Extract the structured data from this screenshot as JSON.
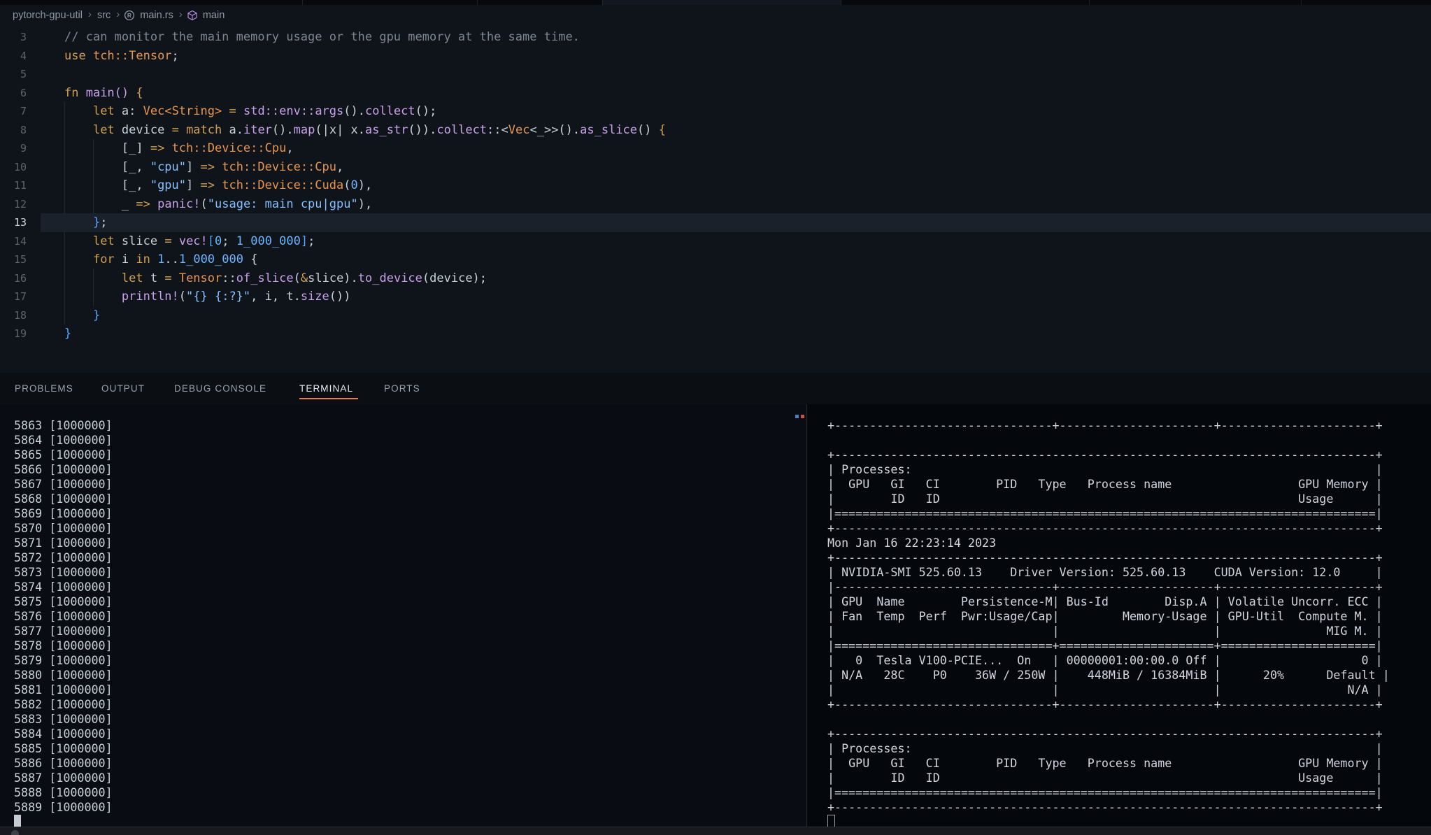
{
  "colors": {
    "accent_underline": "#ee7a50",
    "syntax_keyword": "#d0a050",
    "syntax_type": "#e8964e",
    "syntax_function": "#c9a1e9",
    "syntax_string": "#85c1ff",
    "syntax_number": "#6cb6ff",
    "syntax_comment": "#7d8590",
    "editor_background": "#0f131a",
    "terminal_left_background": "#090d13",
    "terminal_right_background": "#04070c"
  },
  "breadcrumb": {
    "items": [
      {
        "label": "pytorch-gpu-util"
      },
      {
        "label": "src"
      },
      {
        "label": "main.rs",
        "icon": "rust-file-icon"
      },
      {
        "label": "main",
        "icon": "symbol-cube-icon"
      }
    ]
  },
  "editor": {
    "active_line": 13,
    "lines": [
      {
        "n": 3,
        "t": [
          [
            "cm",
            "// can monitor the main memory usage or the gpu memory at the same time."
          ]
        ]
      },
      {
        "n": 4,
        "t": [
          [
            "kw",
            "use "
          ],
          [
            "ty",
            "tch::Tensor"
          ],
          [
            "df",
            ";"
          ]
        ]
      },
      {
        "n": 5,
        "t": []
      },
      {
        "n": 6,
        "t": [
          [
            "kw",
            "fn "
          ],
          [
            "fn",
            "main()"
          ],
          [
            "df",
            " "
          ],
          [
            "kw",
            "{"
          ]
        ]
      },
      {
        "n": 7,
        "t": [
          [
            "df",
            "    "
          ],
          [
            "kw",
            "let"
          ],
          [
            "df",
            " a: "
          ],
          [
            "ty",
            "Vec<String>"
          ],
          [
            "df",
            " "
          ],
          [
            "kw",
            "="
          ],
          [
            "df",
            " "
          ],
          [
            "fn",
            "std::env::args"
          ],
          [
            "df",
            "()."
          ],
          [
            "fn",
            "collect"
          ],
          [
            "df",
            "();"
          ]
        ]
      },
      {
        "n": 8,
        "t": [
          [
            "df",
            "    "
          ],
          [
            "kw",
            "let"
          ],
          [
            "df",
            " device "
          ],
          [
            "kw",
            "="
          ],
          [
            "df",
            " "
          ],
          [
            "kw",
            "match"
          ],
          [
            "df",
            " a."
          ],
          [
            "fn",
            "iter"
          ],
          [
            "df",
            "()."
          ],
          [
            "fn",
            "map"
          ],
          [
            "df",
            "(|x| x."
          ],
          [
            "fn",
            "as_str"
          ],
          [
            "df",
            "())."
          ],
          [
            "fn",
            "collect"
          ],
          [
            "df",
            "::<"
          ],
          [
            "ty",
            "Vec"
          ],
          [
            "df",
            "<_>>()."
          ],
          [
            "fn",
            "as_slice"
          ],
          [
            "df",
            "() "
          ],
          [
            "kw",
            "{"
          ]
        ]
      },
      {
        "n": 9,
        "t": [
          [
            "df",
            "        [_] "
          ],
          [
            "kw",
            "=>"
          ],
          [
            "df",
            " "
          ],
          [
            "ty",
            "tch::Device::Cpu"
          ],
          [
            "df",
            ","
          ]
        ]
      },
      {
        "n": 10,
        "t": [
          [
            "df",
            "        [_, "
          ],
          [
            "st",
            "\"cpu\""
          ],
          [
            "df",
            "] "
          ],
          [
            "kw",
            "=>"
          ],
          [
            "df",
            " "
          ],
          [
            "ty",
            "tch::Device::Cpu"
          ],
          [
            "df",
            ","
          ]
        ]
      },
      {
        "n": 11,
        "t": [
          [
            "df",
            "        [_, "
          ],
          [
            "st",
            "\"gpu\""
          ],
          [
            "df",
            "] "
          ],
          [
            "kw",
            "=>"
          ],
          [
            "df",
            " "
          ],
          [
            "ty",
            "tch::Device::Cuda"
          ],
          [
            "df",
            "("
          ],
          [
            "nu",
            "0"
          ],
          [
            "df",
            "),"
          ]
        ]
      },
      {
        "n": 12,
        "t": [
          [
            "df",
            "        _ "
          ],
          [
            "kw",
            "=>"
          ],
          [
            "df",
            " "
          ],
          [
            "fn",
            "panic!"
          ],
          [
            "df",
            "("
          ],
          [
            "st",
            "\"usage: main cpu|gpu\""
          ],
          [
            "df",
            "),"
          ]
        ]
      },
      {
        "n": 13,
        "t": [
          [
            "df",
            "    "
          ],
          [
            "br",
            "}"
          ],
          [
            "df",
            ";"
          ]
        ]
      },
      {
        "n": 14,
        "t": [
          [
            "df",
            "    "
          ],
          [
            "kw",
            "let"
          ],
          [
            "df",
            " slice "
          ],
          [
            "kw",
            "="
          ],
          [
            "df",
            " "
          ],
          [
            "fn",
            "vec!"
          ],
          [
            "br",
            "["
          ],
          [
            "nu",
            "0"
          ],
          [
            "df",
            "; "
          ],
          [
            "nu",
            "1_000_000"
          ],
          [
            "br",
            "]"
          ],
          [
            "df",
            ";"
          ]
        ]
      },
      {
        "n": 15,
        "t": [
          [
            "df",
            "    "
          ],
          [
            "kw",
            "for"
          ],
          [
            "df",
            " i "
          ],
          [
            "kw",
            "in"
          ],
          [
            "df",
            " "
          ],
          [
            "nu",
            "1"
          ],
          [
            "df",
            ".."
          ],
          [
            "nu",
            "1_000_000"
          ],
          [
            "df",
            " {"
          ]
        ]
      },
      {
        "n": 16,
        "t": [
          [
            "df",
            "        "
          ],
          [
            "kw",
            "let"
          ],
          [
            "df",
            " t "
          ],
          [
            "kw",
            "="
          ],
          [
            "df",
            " "
          ],
          [
            "ty",
            "Tensor"
          ],
          [
            "df",
            "::"
          ],
          [
            "fn",
            "of_slice"
          ],
          [
            "df",
            "("
          ],
          [
            "kw",
            "&"
          ],
          [
            "df",
            "slice)."
          ],
          [
            "fn",
            "to_device"
          ],
          [
            "df",
            "(device);"
          ]
        ]
      },
      {
        "n": 17,
        "t": [
          [
            "df",
            "        "
          ],
          [
            "fn",
            "println!"
          ],
          [
            "df",
            "("
          ],
          [
            "st",
            "\"{} {:?}\""
          ],
          [
            "df",
            ", i, t."
          ],
          [
            "fn",
            "size"
          ],
          [
            "df",
            "())"
          ]
        ]
      },
      {
        "n": 18,
        "t": [
          [
            "df",
            "    "
          ],
          [
            "br",
            "}"
          ]
        ]
      },
      {
        "n": 19,
        "t": [
          [
            "br",
            "}"
          ]
        ]
      }
    ]
  },
  "panel": {
    "tabs": [
      {
        "label": "PROBLEMS",
        "active": false
      },
      {
        "label": "OUTPUT",
        "active": false
      },
      {
        "label": "DEBUG CONSOLE",
        "active": false
      },
      {
        "label": "TERMINAL",
        "active": true
      },
      {
        "label": "PORTS",
        "active": false
      }
    ]
  },
  "terminal": {
    "left": {
      "lines": [
        "5863 [1000000]",
        "5864 [1000000]",
        "5865 [1000000]",
        "5866 [1000000]",
        "5867 [1000000]",
        "5868 [1000000]",
        "5869 [1000000]",
        "5870 [1000000]",
        "5871 [1000000]",
        "5872 [1000000]",
        "5873 [1000000]",
        "5874 [1000000]",
        "5875 [1000000]",
        "5876 [1000000]",
        "5877 [1000000]",
        "5878 [1000000]",
        "5879 [1000000]",
        "5880 [1000000]",
        "5881 [1000000]",
        "5882 [1000000]",
        "5883 [1000000]",
        "5884 [1000000]",
        "5885 [1000000]",
        "5886 [1000000]",
        "5887 [1000000]",
        "5888 [1000000]",
        "5889 [1000000]"
      ]
    },
    "right": {
      "timestamp": "Mon Jan 16 22:23:14 2023",
      "nvidia_smi_version": "525.60.13",
      "driver_version": "525.60.13",
      "cuda_version": "12.0",
      "gpu_name": "Tesla V100-PCIE...",
      "gpu_util": "20%",
      "memory_usage": "448MiB / 16384MiB",
      "power": "36W / 250W",
      "temp": "28C",
      "lines": [
        "+-------------------------------+----------------------+----------------------+",
        "",
        "+-----------------------------------------------------------------------------+",
        "| Processes:                                                                  |",
        "|  GPU   GI   CI        PID   Type   Process name                  GPU Memory |",
        "|        ID   ID                                                   Usage      |",
        "|=============================================================================|",
        "+-----------------------------------------------------------------------------+",
        "Mon Jan 16 22:23:14 2023",
        "+-----------------------------------------------------------------------------+",
        "| NVIDIA-SMI 525.60.13    Driver Version: 525.60.13    CUDA Version: 12.0     |",
        "|-------------------------------+----------------------+----------------------+",
        "| GPU  Name        Persistence-M| Bus-Id        Disp.A | Volatile Uncorr. ECC |",
        "| Fan  Temp  Perf  Pwr:Usage/Cap|         Memory-Usage | GPU-Util  Compute M. |",
        "|                               |                      |               MIG M. |",
        "|===============================+======================+======================|",
        "|   0  Tesla V100-PCIE...  On   | 00000001:00:00.0 Off |                    0 |",
        "| N/A   28C    P0    36W / 250W |    448MiB / 16384MiB |      20%      Default |",
        "|                               |                      |                  N/A |",
        "+-------------------------------+----------------------+----------------------+",
        "",
        "+-----------------------------------------------------------------------------+",
        "| Processes:                                                                  |",
        "|  GPU   GI   CI        PID   Type   Process name                  GPU Memory |",
        "|        ID   ID                                                   Usage      |",
        "|=============================================================================|",
        "+-----------------------------------------------------------------------------+"
      ]
    }
  }
}
